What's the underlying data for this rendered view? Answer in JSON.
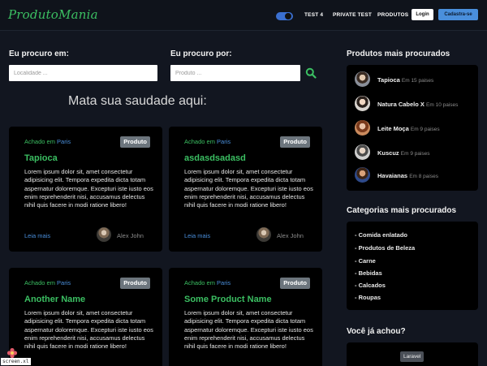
{
  "navbar": {
    "brand": "ProdutoMania",
    "links": [
      "TEST 4",
      "PRIVATE TEST",
      "PRODUTOS"
    ],
    "login_label": "Login",
    "register_label": "Cadastra-se"
  },
  "search": {
    "location_label": "Eu procuro em:",
    "location_placeholder": "Localidade ...",
    "product_label": "Eu procuro por:",
    "product_placeholder": "Produto ..."
  },
  "main": {
    "section_title": "Mata sua saudade aqui:"
  },
  "cards": [
    {
      "found_prefix": "Achado em",
      "city": "Paris",
      "badge": "Produto",
      "title": "Tapioca",
      "text": "Lorem ipsum dolor sit, amet consectetur adipisicing elit. Tempora expedita dicta totam aspernatur doloremque. Excepturi iste iusto eos enim reprehenderit nisi, accusamus delectus nihil quis facere in modi ratione libero!",
      "read_more": "Leia mais",
      "author": "Alex John"
    },
    {
      "found_prefix": "Achado em",
      "city": "Paris",
      "badge": "Produto",
      "title": "asdasdsadasd",
      "text": "Lorem ipsum dolor sit, amet consectetur adipisicing elit. Tempora expedita dicta totam aspernatur doloremque. Excepturi iste iusto eos enim reprehenderit nisi, accusamus delectus nihil quis facere in modi ratione libero!",
      "read_more": "Leia mais",
      "author": "Alex John"
    },
    {
      "found_prefix": "Achado em",
      "city": "Paris",
      "badge": "Produto",
      "title": "Another Name",
      "text": "Lorem ipsum dolor sit, amet consectetur adipisicing elit. Tempora expedita dicta totam aspernatur doloremque. Excepturi iste iusto eos enim reprehenderit nisi, accusamus delectus nihil quis facere in modi ratione libero!"
    },
    {
      "found_prefix": "Achado em",
      "city": "Paris",
      "badge": "Produto",
      "title": "Some Product Name",
      "text": "Lorem ipsum dolor sit, amet consectetur adipisicing elit. Tempora expedita dicta totam aspernatur doloremque. Excepturi iste iusto eos enim reprehenderit nisi, accusamus delectus nihil quis facere in modi ratione libero!"
    }
  ],
  "sidebar": {
    "popular_title": "Produtos mais procurados",
    "popular": [
      {
        "name": "Tapioca",
        "meta": "Em 15 paises"
      },
      {
        "name": "Natura Cabelo X",
        "meta": "Em 10 paises"
      },
      {
        "name": "Leite Moça",
        "meta": "Em 9 paises"
      },
      {
        "name": "Kuscuz",
        "meta": "Em 9 paises"
      },
      {
        "name": "Havaianas",
        "meta": "Em 8 paises"
      }
    ],
    "categories_title": "Categorias mais procurados",
    "categories": [
      "- Comida enlatado",
      "- Produtos de Beleza",
      "- Carne",
      "- Bebidas",
      "- Calcados",
      "- Roupas"
    ],
    "found_title": "Você já achou?",
    "found_badge": "Laravel"
  },
  "watermark": "screen.xl",
  "colors": {
    "background": "#121620",
    "accent_green": "#3bbf62",
    "accent_blue": "#4a8fdc",
    "badge_gray": "#6c757d"
  }
}
